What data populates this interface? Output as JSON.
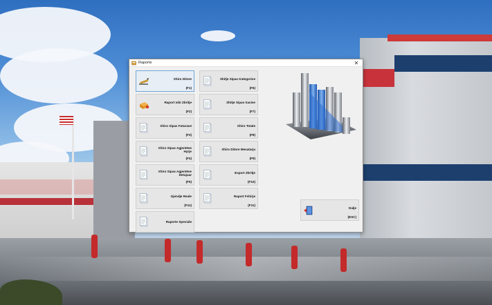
{
  "window": {
    "title": "Raporte",
    "close_glyph": "✕"
  },
  "buttons": {
    "xhiro_ditore": {
      "label": "Xhiro Ditore",
      "key": "(F1)",
      "icon": "pencil-icon"
    },
    "raport_mbi_zbritje": {
      "label": "Raport mbi Zbritje",
      "key": "(F2)",
      "icon": "gift-icon"
    },
    "xhiro_sipas_faturave": {
      "label": "Xhiro Sipas Faturave",
      "key": "(F3)",
      "icon": "document-icon"
    },
    "xhiro_sipas_agjentëve_hyrje": {
      "label": "Xhiro Sipas Agjentëve Hyrje",
      "key": "(F4)",
      "icon": "document-icon"
    },
    "xhiro_sipas_agjentëve_detajuar": {
      "label": "Xhiro Sipas Agjentëve Detajuar",
      "key": "(F5)",
      "icon": "document-icon"
    },
    "gjendje_reale": {
      "label": "Gjendje Reale",
      "key": "(F11)",
      "icon": "document-icon"
    },
    "raporte_speciale": {
      "label": "Raporte Speciale",
      "key": "",
      "icon": "document-icon"
    },
    "shitje_sipas_kategorive": {
      "label": "Shitje Sipas Kategorive",
      "key": "(F6)",
      "icon": "document-icon"
    },
    "shitje_sipas_sasise": {
      "label": "Shitje Sipas Sasise",
      "key": "(F7)",
      "icon": "document-icon"
    },
    "xhiro_totale": {
      "label": "Xhiro Totale",
      "key": "(F8)",
      "icon": "document-icon"
    },
    "xhiro_ditore_mesatarja": {
      "label": "Xhiro Ditore Mesatarja",
      "key": "(F9)",
      "icon": "document-icon"
    },
    "export_zbritje": {
      "label": "Export Zbritje",
      "key": "(F10)",
      "icon": "document-icon"
    },
    "raport_fshirje": {
      "label": "Raport Fshirje",
      "key": "(F11)",
      "icon": "document-icon"
    },
    "dalje": {
      "label": "Dalje",
      "key": "(ESC)",
      "icon": "exit-door-icon"
    }
  },
  "logo": {
    "icon": "bar-chart-logo-icon"
  },
  "colors": {
    "chart_blue": "#2f6fd0",
    "chart_silver": "#c8ccd2",
    "active_border": "#6fa7da"
  }
}
